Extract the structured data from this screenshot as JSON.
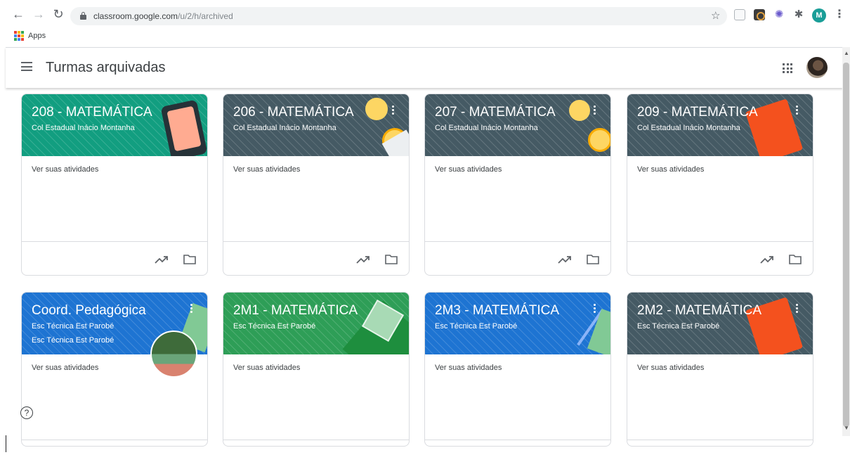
{
  "browser": {
    "url_host": "classroom.google.com",
    "url_path": "/u/2/h/archived",
    "profile_initial": "M",
    "bookmarks_label": "Apps"
  },
  "header": {
    "title": "Turmas arquivadas"
  },
  "icons": {
    "back": "arrow-left-icon",
    "forward": "arrow-right-icon",
    "reload": "reload-icon",
    "lock": "lock-icon",
    "star": "star-icon",
    "menu": "hamburger-icon",
    "apps": "waffle-icon",
    "trend": "trending-up-icon",
    "folder": "folder-icon",
    "help": "help-icon"
  },
  "colors": {
    "teal": "#129e80",
    "slate": "#455a64",
    "blue": "#1e74d2",
    "green": "#2e9e57"
  },
  "classes": [
    {
      "title": "208 - MATEMÁTICA",
      "subtitle": "Col Estadual Inácio Montanha",
      "activity": "Ver suas atividades"
    },
    {
      "title": "206 - MATEMÁTICA",
      "subtitle": "Col Estadual Inácio Montanha",
      "activity": "Ver suas atividades"
    },
    {
      "title": "207 - MATEMÁTICA",
      "subtitle": "Col Estadual Inácio Montanha",
      "activity": "Ver suas atividades"
    },
    {
      "title": "209 - MATEMÁTICA",
      "subtitle": "Col Estadual Inácio Montanha",
      "activity": "Ver suas atividades"
    },
    {
      "title": "Coord. Pedagógica",
      "subtitle": "Esc Técnica Est Parobé",
      "subtitle2": "Esc Técnica Est Parobé",
      "activity": "Ver suas atividades"
    },
    {
      "title": "2M1 - MATEMÁTICA",
      "subtitle": "Esc Técnica Est Parobé",
      "activity": "Ver suas atividades"
    },
    {
      "title": "2M3 - MATEMÁTICA",
      "subtitle": "Esc Técnica Est Parobé",
      "activity": "Ver suas atividades"
    },
    {
      "title": "2M2 - MATEMÁTICA",
      "subtitle": "Esc Técnica Est Parobé",
      "activity": "Ver suas atividades"
    }
  ]
}
